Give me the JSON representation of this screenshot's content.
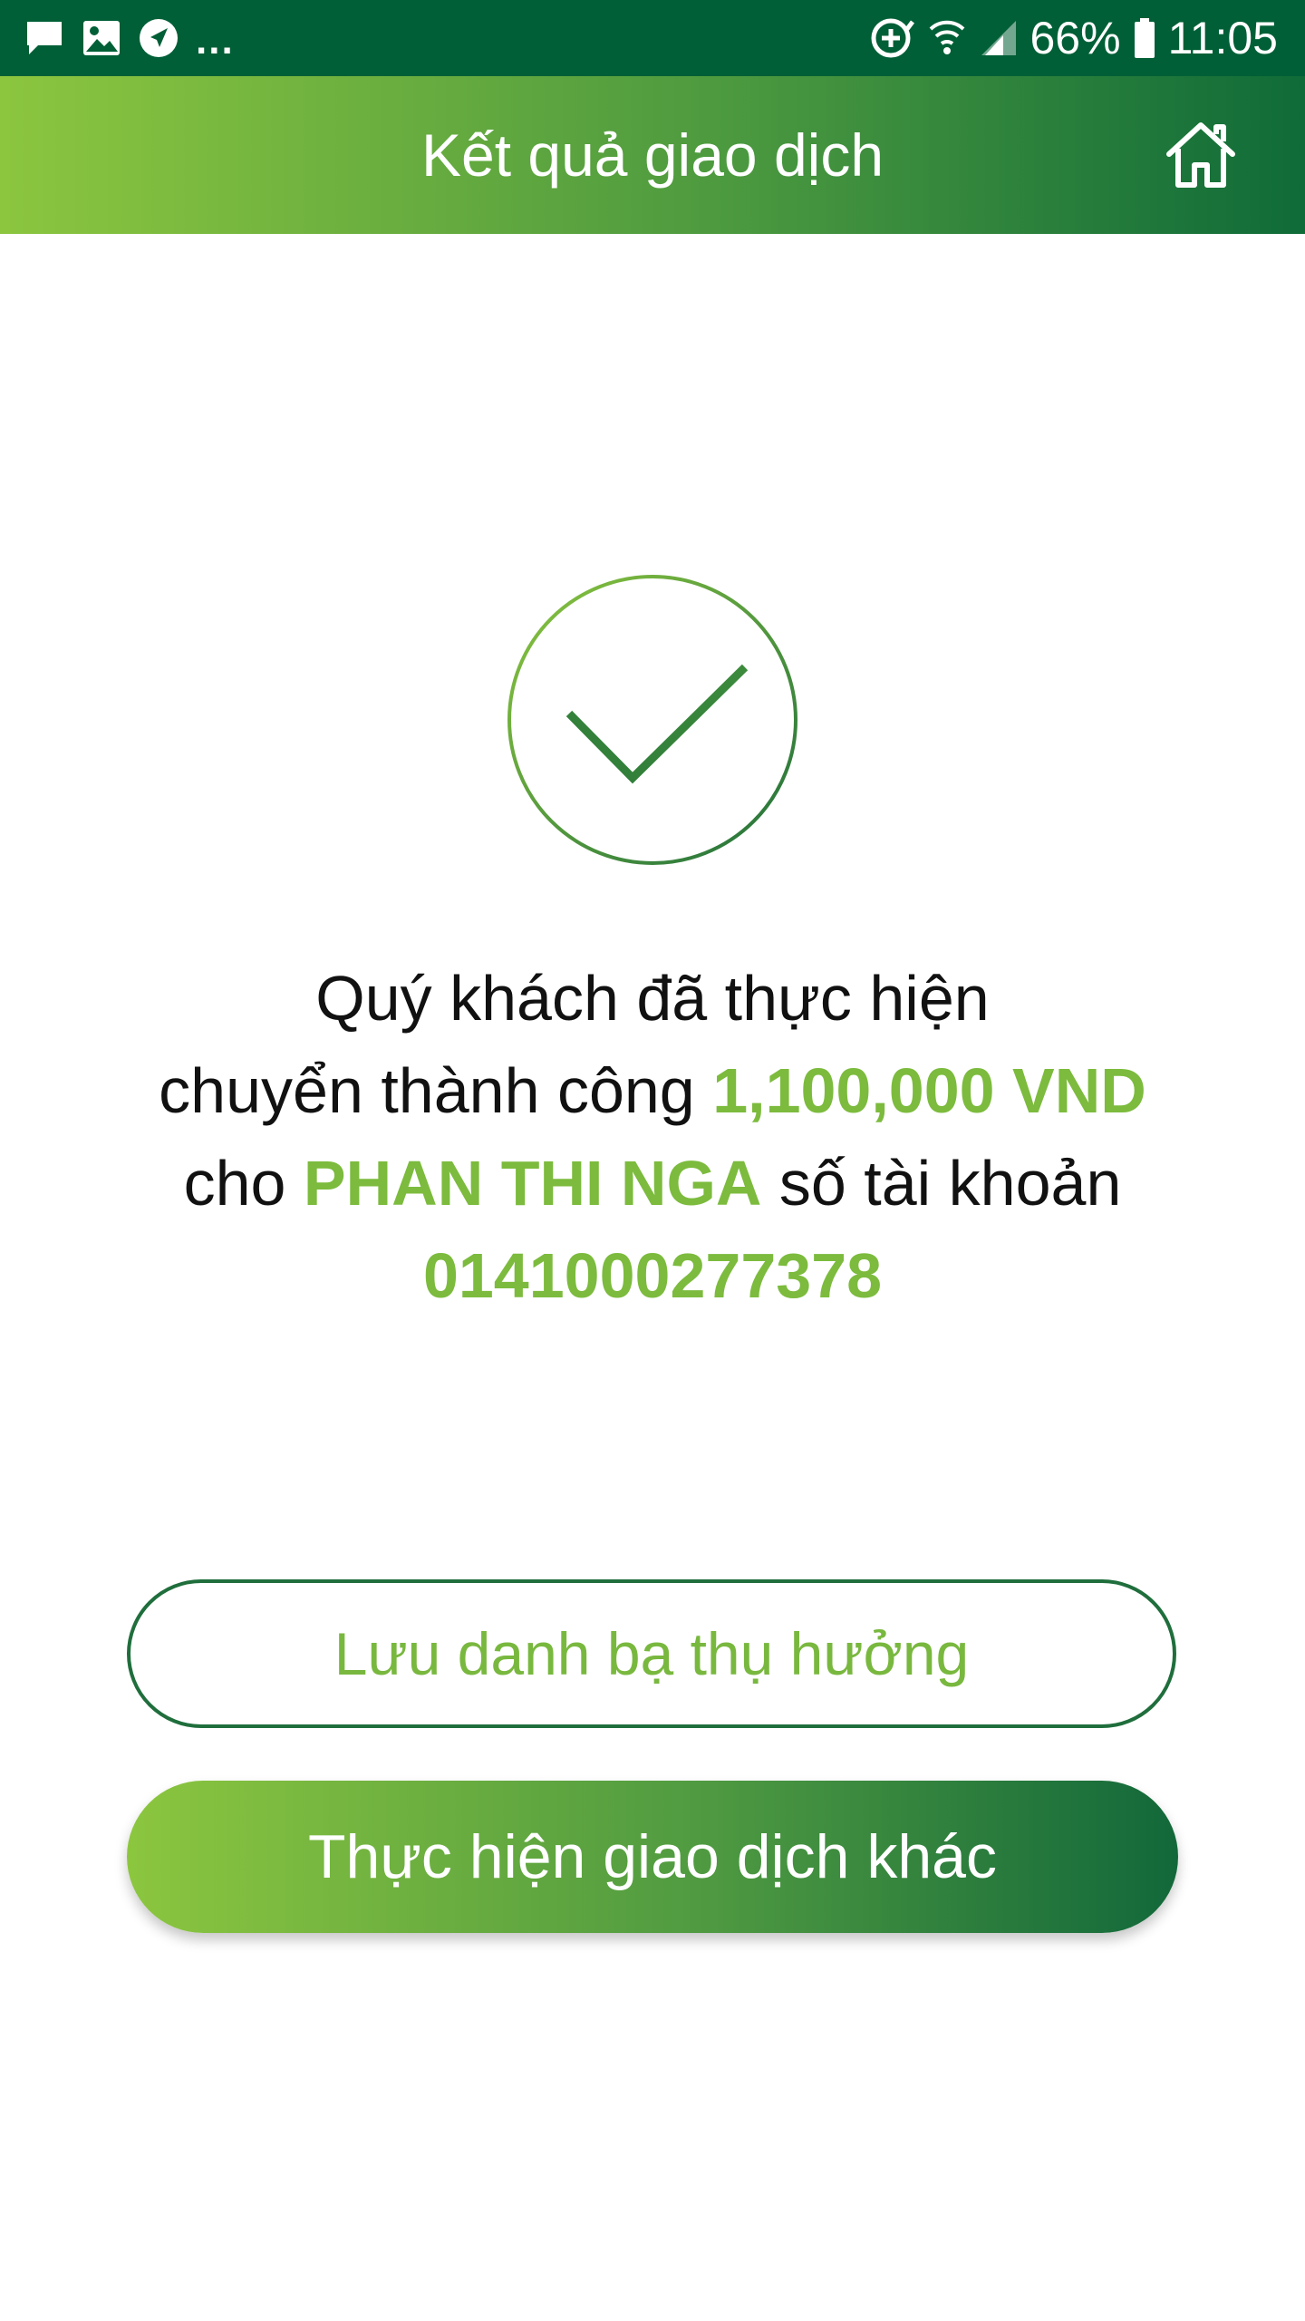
{
  "status_bar": {
    "battery": "66%",
    "time": "11:05",
    "more": "..."
  },
  "header": {
    "title": "Kết quả giao dịch"
  },
  "message": {
    "line1": "Quý khách đã thực hiện",
    "line2_prefix": "chuyển thành công ",
    "amount": "1,100,000 VND",
    "line3_prefix": "cho ",
    "recipient": "PHAN THI NGA",
    "line3_suffix": " số tài khoản",
    "account": "0141000277378"
  },
  "buttons": {
    "save_contact": "Lưu danh bạ thụ hưởng",
    "new_transaction": "Thực hiện giao dịch khác"
  },
  "colors": {
    "status_bar": "#005f36",
    "accent_green": "#7cbb3d",
    "dark_green": "#1f6e3c"
  }
}
